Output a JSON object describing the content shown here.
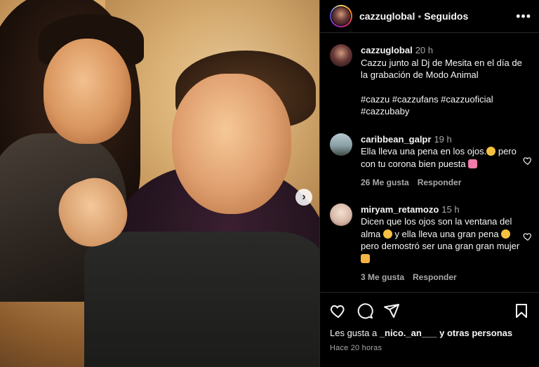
{
  "post": {
    "username": "cazzuglobal",
    "separator": "•",
    "follow_status": "Seguidos",
    "more_icon": "more-options-icon",
    "next_icon": "chevron-right-icon"
  },
  "caption": {
    "username": "cazzuglobal",
    "time": "20 h",
    "text": "Cazzu junto al Dj de Mesita en el día de la grabación de Modo Animal",
    "hashtags": "#cazzu #cazzufans #cazzuoficial #cazzubaby"
  },
  "comments": [
    {
      "username": "caribbean_galpr",
      "time": "19 h",
      "text_a": "Ella lleva una pena en los ojos.",
      "text_b": " pero con tu corona bien puesta ",
      "likes": "26 Me gusta",
      "reply": "Responder"
    },
    {
      "username": "miryam_retamozo",
      "time": "15 h",
      "text_a": "Dicen que los ojos son la ventana del alma ",
      "text_b": " y ella lleva una gran pena ",
      "text_c": " pero demostró ser una gran gran mujer ",
      "likes": "3 Me gusta",
      "reply": "Responder"
    }
  ],
  "footer": {
    "liked_prefix": "Les gusta a ",
    "liked_user": "_nico._an___",
    "liked_suffix": " y otras personas",
    "ago": "Hace 20 horas"
  },
  "colors": {
    "background": "#000000",
    "text": "#f5f5f5",
    "muted": "#a8a8a8",
    "divider": "#262626"
  }
}
